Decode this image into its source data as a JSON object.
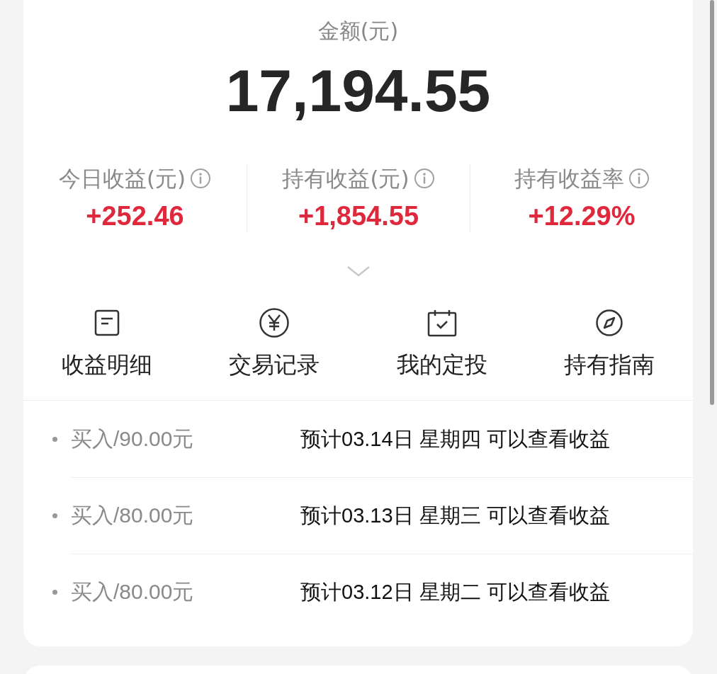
{
  "balance": {
    "label": "金额(元)",
    "value": "17,194.55"
  },
  "stats": [
    {
      "label": "今日收益(元)",
      "value": "+252.46"
    },
    {
      "label": "持有收益(元)",
      "value": "+1,854.55"
    },
    {
      "label": "持有收益率",
      "value": "+12.29%"
    }
  ],
  "actions": [
    {
      "kind": "document",
      "label": "收益明细"
    },
    {
      "kind": "yen",
      "label": "交易记录"
    },
    {
      "kind": "calendar",
      "label": "我的定投"
    },
    {
      "kind": "compass",
      "label": "持有指南"
    }
  ],
  "transactions": [
    {
      "amount": "买入/90.00元",
      "note": "预计03.14日 星期四 可以查看收益"
    },
    {
      "amount": "买入/80.00元",
      "note": "预计03.13日 星期三 可以查看收益"
    },
    {
      "amount": "买入/80.00元",
      "note": "预计03.12日 星期二 可以查看收益"
    }
  ]
}
